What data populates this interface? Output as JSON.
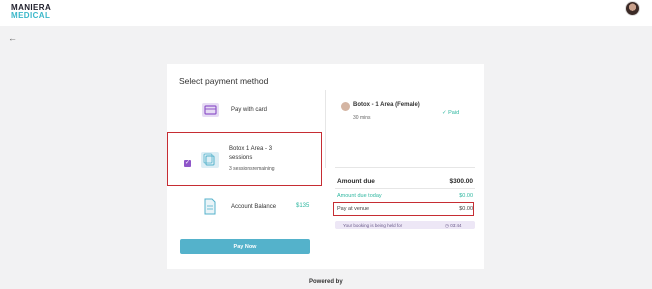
{
  "brand": {
    "line1": "MANIERA",
    "line2": "MEDICAL"
  },
  "header": {
    "title": "Select payment method"
  },
  "payment_options": [
    {
      "label": "Pay with card"
    },
    {
      "label_line1": "Botox 1 Area - 3",
      "label_line2": "sessions",
      "sub": "3 sessionsremaining",
      "checked": true
    },
    {
      "label": "Account Balance",
      "amount": "$135"
    }
  ],
  "pay_button": "Pay Now",
  "booking": {
    "service": "Botox - 1 Area (Female)",
    "duration": "30 mins",
    "status": "Paid"
  },
  "summary": {
    "amount_due_label": "Amount due",
    "amount_due_value": "$300.00",
    "due_today_label": "Amount due today",
    "due_today_value": "$0.00",
    "pay_venue_label": "Pay at venue",
    "pay_venue_value": "$0.00"
  },
  "hold": {
    "text": "Your booking is being held for",
    "time": "03:44"
  },
  "footer": "Powered by",
  "colors": {
    "accent": "#8f56c9",
    "teal": "#2fb7a0",
    "button": "#54b2cb",
    "highlight": "#c62d33"
  }
}
